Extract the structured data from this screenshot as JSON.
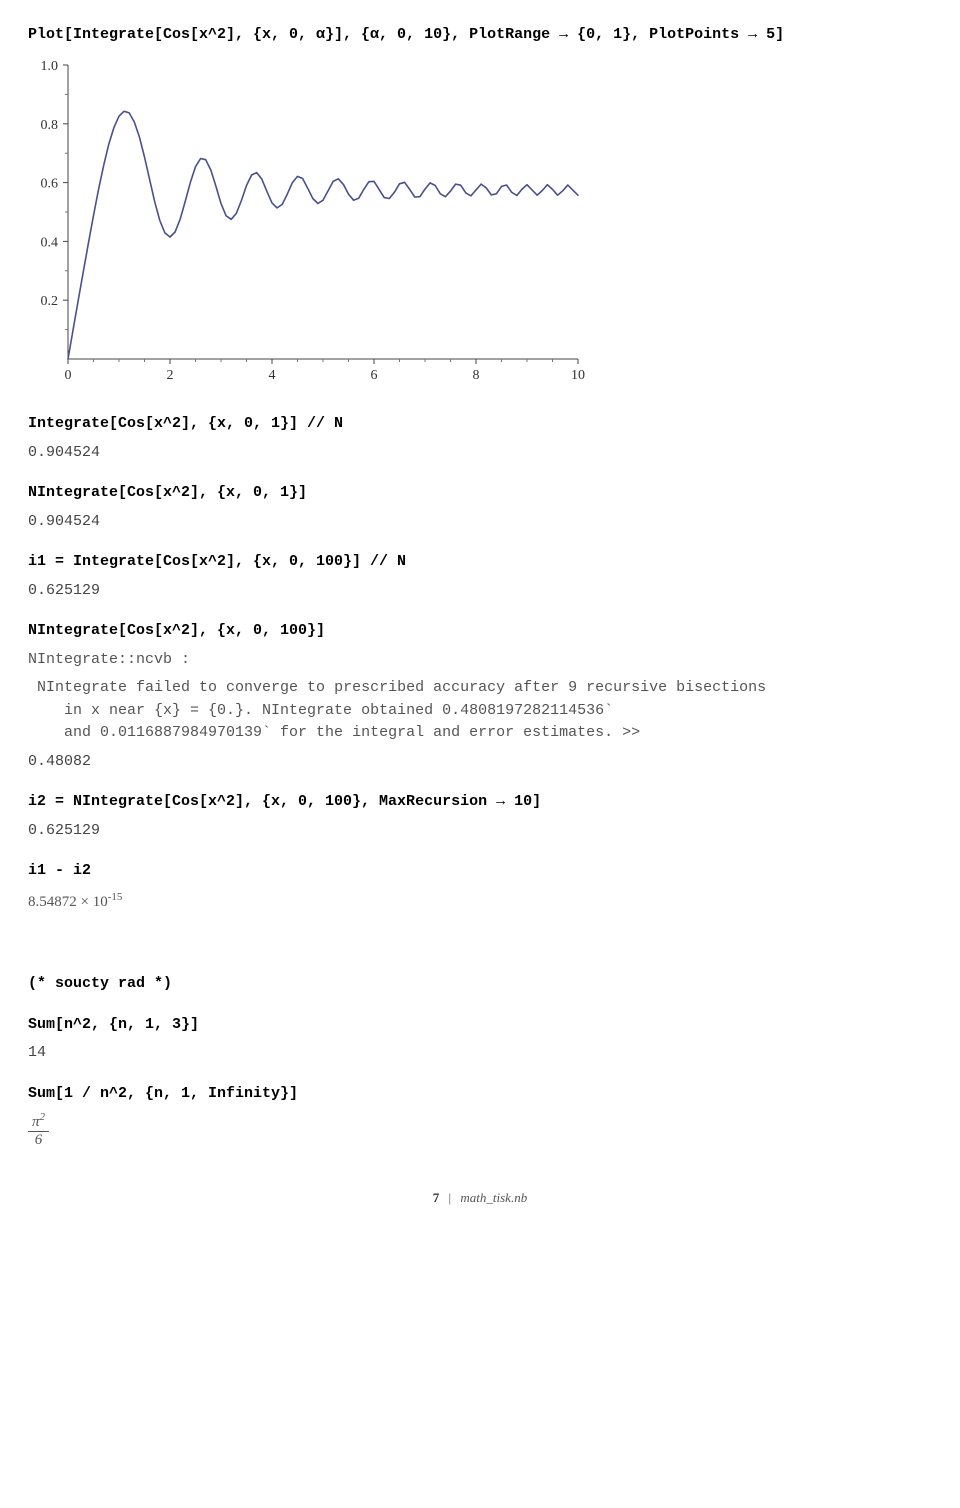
{
  "chart_data": {
    "type": "line",
    "title": "",
    "xlabel": "",
    "ylabel": "",
    "xlim": [
      0,
      10
    ],
    "ylim": [
      0,
      1
    ],
    "x_ticks": [
      0,
      2,
      4,
      6,
      8,
      10
    ],
    "y_ticks": [
      0.2,
      0.4,
      0.6,
      0.8,
      1.0
    ],
    "series_name": "Integrate[Cos[x^2],{x,0,α}]",
    "x": [
      0,
      0.1,
      0.2,
      0.3,
      0.4,
      0.5,
      0.6,
      0.7,
      0.8,
      0.9,
      1.0,
      1.1,
      1.2,
      1.3,
      1.4,
      1.5,
      1.6,
      1.7,
      1.8,
      1.9,
      2.0,
      2.1,
      2.2,
      2.3,
      2.4,
      2.5,
      2.6,
      2.7,
      2.8,
      2.9,
      3.0,
      3.1,
      3.2,
      3.3,
      3.4,
      3.5,
      3.6,
      3.7,
      3.8,
      3.9,
      4.0,
      4.1,
      4.2,
      4.3,
      4.4,
      4.5,
      4.6,
      4.7,
      4.8,
      4.9,
      5.0,
      5.1,
      5.2,
      5.3,
      5.4,
      5.5,
      5.6,
      5.7,
      5.8,
      5.9,
      6.0,
      6.1,
      6.2,
      6.3,
      6.4,
      6.5,
      6.6,
      6.7,
      6.8,
      6.9,
      7.0,
      7.1,
      7.2,
      7.3,
      7.4,
      7.5,
      7.6,
      7.7,
      7.8,
      7.9,
      8.0,
      8.1,
      8.2,
      8.3,
      8.4,
      8.5,
      8.6,
      8.7,
      8.8,
      8.9,
      9.0,
      9.1,
      9.2,
      9.3,
      9.4,
      9.5,
      9.6,
      9.7,
      9.8,
      9.9,
      10.0
    ],
    "y": [
      0.0,
      0.1,
      0.199,
      0.297,
      0.394,
      0.488,
      0.578,
      0.659,
      0.731,
      0.787,
      0.826,
      0.843,
      0.837,
      0.806,
      0.755,
      0.687,
      0.611,
      0.535,
      0.471,
      0.429,
      0.415,
      0.432,
      0.476,
      0.537,
      0.601,
      0.654,
      0.682,
      0.678,
      0.643,
      0.588,
      0.529,
      0.487,
      0.475,
      0.495,
      0.539,
      0.59,
      0.626,
      0.634,
      0.612,
      0.57,
      0.531,
      0.514,
      0.526,
      0.561,
      0.6,
      0.621,
      0.614,
      0.581,
      0.546,
      0.529,
      0.54,
      0.572,
      0.604,
      0.613,
      0.594,
      0.561,
      0.54,
      0.547,
      0.577,
      0.603,
      0.604,
      0.577,
      0.549,
      0.546,
      0.567,
      0.596,
      0.601,
      0.577,
      0.551,
      0.552,
      0.578,
      0.599,
      0.59,
      0.562,
      0.552,
      0.571,
      0.595,
      0.591,
      0.565,
      0.555,
      0.575,
      0.595,
      0.582,
      0.558,
      0.562,
      0.587,
      0.592,
      0.567,
      0.556,
      0.577,
      0.593,
      0.575,
      0.557,
      0.573,
      0.593,
      0.577,
      0.557,
      0.572,
      0.592,
      0.574,
      0.557
    ]
  },
  "code": {
    "plot": "Plot[Integrate[Cos[x^2], {x, 0, α}], {α, 0, 10}, PlotRange → {0, 1}, PlotPoints → 5]",
    "int1": "Integrate[Cos[x^2], {x, 0, 1}] // N",
    "out1": "0.904524",
    "nint1": "NIntegrate[Cos[x^2], {x, 0, 1}]",
    "out1b": "0.904524",
    "i1def": "i1 = Integrate[Cos[x^2], {x, 0, 100}] // N",
    "out2": "0.625129",
    "nint100": "NIntegrate[Cos[x^2], {x, 0, 100}]",
    "msg_head": "NIntegrate::ncvb :",
    "msg_body": " NIntegrate failed to converge to prescribed accuracy after 9 recursive bisections\n    in x near {x} = {0.}. NIntegrate obtained 0.4808197282114536`\n    and 0.0116887984970139` for the integral and error estimates. >>",
    "out3": "0.48082",
    "i2def": "i2 = NIntegrate[Cos[x^2], {x, 0, 100}, MaxRecursion → 10]",
    "out4": "0.625129",
    "diff": "i1 - i2",
    "out5_mantissa": "8.54872",
    "out5_times": " × 10",
    "out5_exp": "-15",
    "comment": "(* soucty rad *)",
    "sum1": "Sum[n^2, {n, 1, 3}]",
    "out6": "14",
    "sum2": "Sum[1 / n^2, {n, 1, Infinity}]",
    "frac_num": "π",
    "frac_num_exp": "2",
    "frac_den": "6"
  },
  "footer": {
    "page": "7",
    "sep": "|",
    "file": "math_tisk.nb"
  }
}
